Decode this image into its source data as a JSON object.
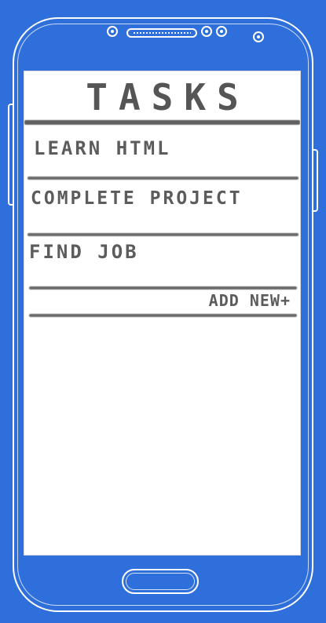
{
  "app": {
    "title": "TASKS"
  },
  "tasks": [
    {
      "label": "LEARN HTML"
    },
    {
      "label": "COMPLETE PROJECT"
    },
    {
      "label": "FIND JOB"
    }
  ],
  "actions": {
    "add_new_label": "ADD NEW+"
  },
  "colors": {
    "background": "#2f6fdb",
    "screen": "#ffffff",
    "ink": "#5c5c5c",
    "outline": "#ffffff"
  }
}
